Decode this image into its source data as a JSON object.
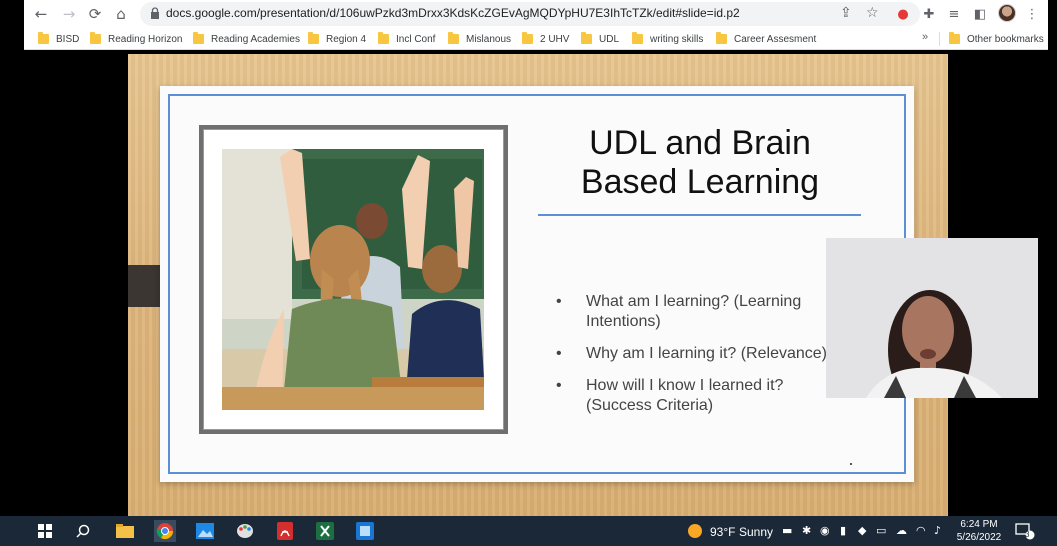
{
  "browser": {
    "url": "docs.google.com/presentation/d/106uwPzkd3mDrxx3KdsKcZGEvAgMQDYpHU7E3IhTcTZk/edit#slide=id.p2",
    "bookmarks": [
      "BISD",
      "Reading Horizon",
      "Reading Academies",
      "Region 4",
      "Incl Conf",
      "Mislanous",
      "2 UHV",
      "UDL",
      "writing skills",
      "Career Assesment"
    ],
    "more_bookmarks": "»",
    "other_bookmarks": "Other bookmarks"
  },
  "slide": {
    "title_line1": "UDL and Brain",
    "title_line2": "Based Learning",
    "bullets": [
      {
        "line1": "What am I learning? (Learning",
        "line2": "Intentions)"
      },
      {
        "line1": "Why am I learning it? (Relevance)",
        "line2": ""
      },
      {
        "line1": "How will I know I learned it?",
        "line2": "(Success Criteria)"
      }
    ],
    "bullet_marker": "•"
  },
  "taskbar": {
    "weather_temp": "93°F",
    "weather_desc": "Sunny",
    "time": "6:24 PM",
    "date": "5/26/2022",
    "notification_count": "3"
  },
  "colors": {
    "accent": "#5b8fd6",
    "taskbar": "#1b2838",
    "wood": "#deb57c"
  }
}
